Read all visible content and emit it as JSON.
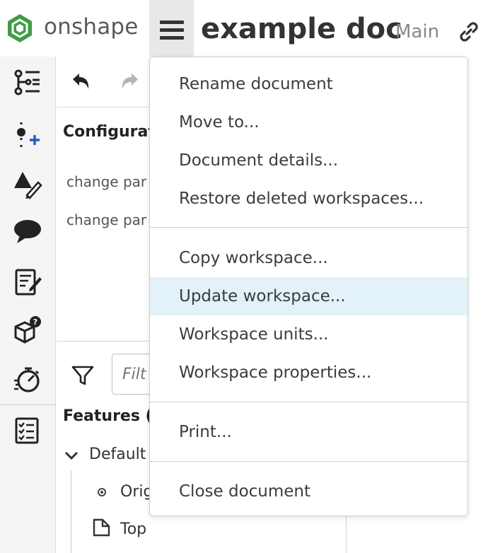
{
  "app": {
    "brand": "onshape",
    "document_title": "example doc",
    "branch": "Main"
  },
  "sidebar": {
    "icons": [
      "feature-list-icon",
      "insert-part-icon",
      "appearance-icon",
      "comments-icon",
      "notes-icon",
      "parts-query-icon",
      "rollback-timer-icon",
      "checklist-icon"
    ]
  },
  "panel": {
    "config_title": "Configurat",
    "change_rows": [
      "change par",
      "change par"
    ],
    "filter_placeholder": "Filt",
    "features_title": "Features (",
    "default_label": "Default",
    "origin_label": "Origi",
    "top_label": "Top"
  },
  "menu": {
    "group1": [
      "Rename document",
      "Move to...",
      "Document details...",
      "Restore deleted workspaces..."
    ],
    "group2": [
      "Copy workspace...",
      "Update workspace...",
      "Workspace units...",
      "Workspace properties..."
    ],
    "group3": [
      "Print..."
    ],
    "group4": [
      "Close document"
    ],
    "highlighted": "Update workspace..."
  },
  "colors": {
    "highlight": "#e3f1f8",
    "brand_green": "#3f9c48",
    "toolbar_bg": "#f5f5f5",
    "accent_blue": "#1f5fbf"
  }
}
